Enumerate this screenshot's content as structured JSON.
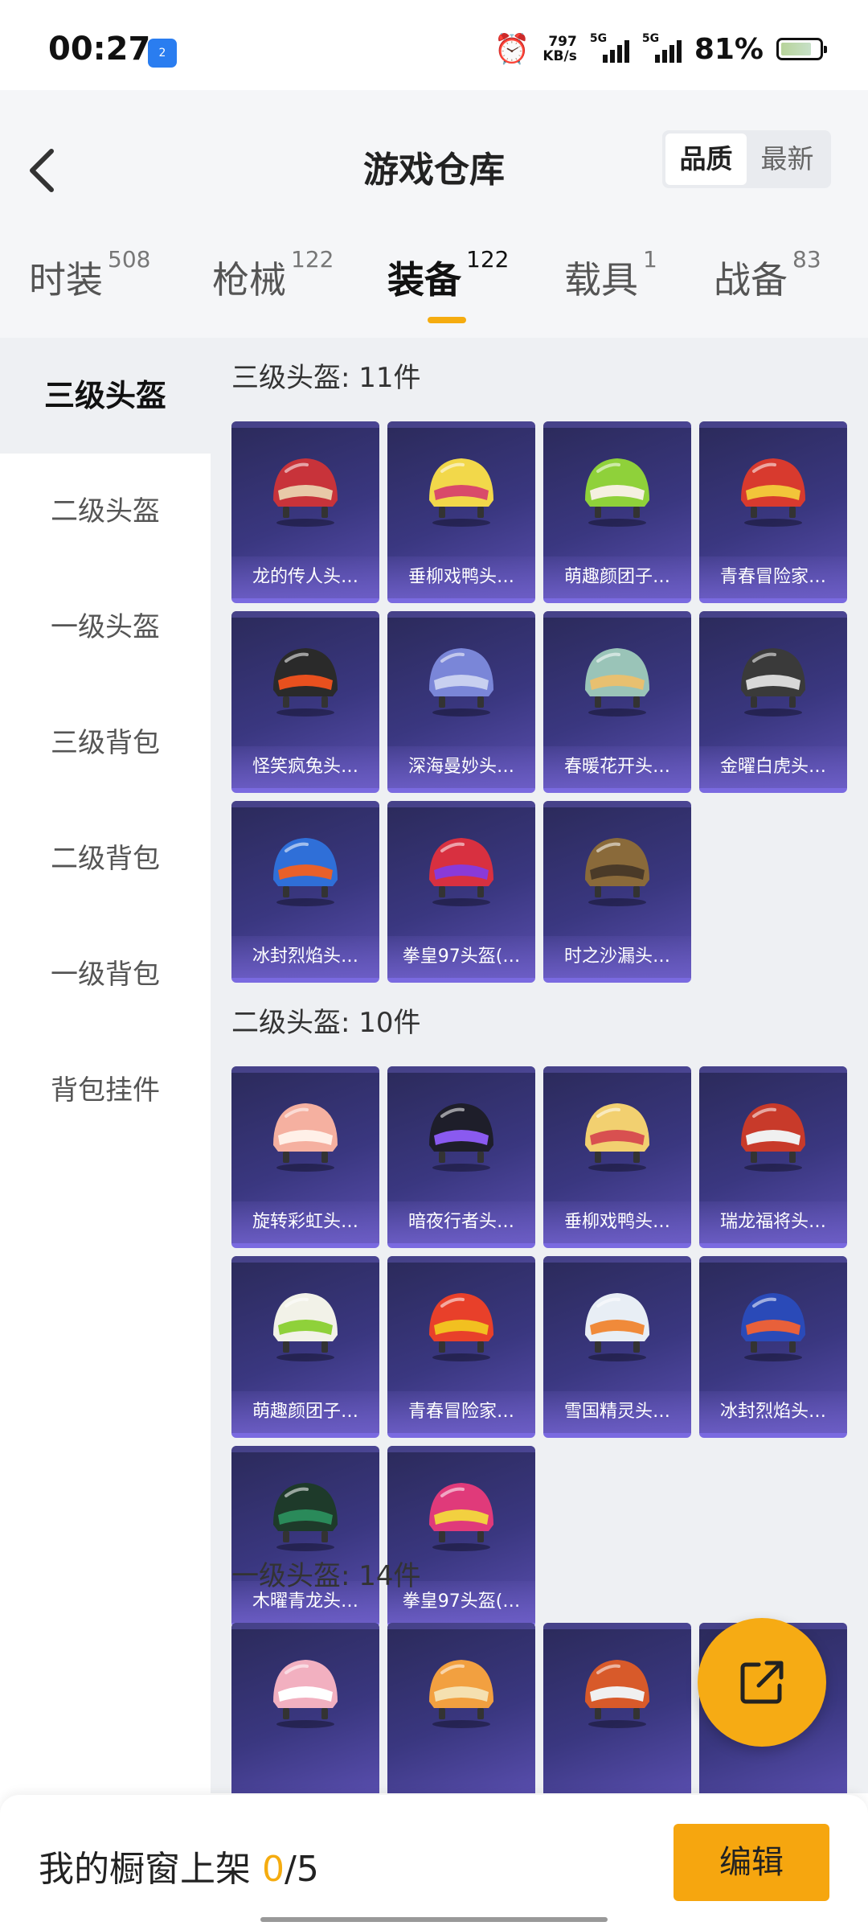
{
  "status_bar": {
    "time": "00:27",
    "badge": "2",
    "net_speed_top": "797",
    "net_speed_bottom": "KB/s",
    "signal1_label": "5G",
    "signal2_label": "5G",
    "battery": "81%",
    "battery_level": 0.81
  },
  "header": {
    "title": "游戏仓库",
    "sort_options": [
      "品质",
      "最新"
    ],
    "active_sort": "品质"
  },
  "tabs": [
    {
      "label": "时装",
      "count": "508"
    },
    {
      "label": "枪械",
      "count": "122"
    },
    {
      "label": "装备",
      "count": "122"
    },
    {
      "label": "载具",
      "count": "1"
    },
    {
      "label": "战备",
      "count": "83"
    }
  ],
  "active_tab": "装备",
  "sidebar": {
    "items": [
      "三级头盔",
      "二级头盔",
      "一级头盔",
      "三级背包",
      "二级背包",
      "一级背包",
      "背包挂件"
    ],
    "active": "三级头盔"
  },
  "sections": [
    {
      "title": "三级头盔: 11件",
      "items": [
        {
          "name": "龙的传人头…",
          "c1": "#c8333a",
          "c2": "#e8c9a8"
        },
        {
          "name": "垂柳戏鸭头…",
          "c1": "#f2d84a",
          "c2": "#d94a6a"
        },
        {
          "name": "萌趣颜团子…",
          "c1": "#8fd13a",
          "c2": "#f5f0e0"
        },
        {
          "name": "青春冒险家…",
          "c1": "#d83a2e",
          "c2": "#f2c53a"
        },
        {
          "name": "怪笑疯兔头…",
          "c1": "#2a2a2a",
          "c2": "#e8501e"
        },
        {
          "name": "深海曼妙头…",
          "c1": "#7a86d8",
          "c2": "#c8d0f0"
        },
        {
          "name": "春暖花开头…",
          "c1": "#9ac4b8",
          "c2": "#e8c070"
        },
        {
          "name": "金曜白虎头…",
          "c1": "#3a3a3a",
          "c2": "#d8d8d8"
        },
        {
          "name": "冰封烈焰头…",
          "c1": "#2f6fd8",
          "c2": "#e8602a"
        },
        {
          "name": "拳皇97头盔(…",
          "c1": "#d83040",
          "c2": "#8a3ad8"
        },
        {
          "name": "时之沙漏头…",
          "c1": "#8a6a3a",
          "c2": "#4a3a28"
        }
      ]
    },
    {
      "title": "二级头盔: 10件",
      "items": [
        {
          "name": "旋转彩虹头…",
          "c1": "#f5b0a0",
          "c2": "#fff0e8"
        },
        {
          "name": "暗夜行者头…",
          "c1": "#1e1e2a",
          "c2": "#8a5af0"
        },
        {
          "name": "垂柳戏鸭头…",
          "c1": "#f2d070",
          "c2": "#d85050"
        },
        {
          "name": "瑞龙福将头…",
          "c1": "#c83a2a",
          "c2": "#f0f0f0"
        },
        {
          "name": "萌趣颜团子…",
          "c1": "#f2f2e8",
          "c2": "#8fd13a"
        },
        {
          "name": "青春冒险家…",
          "c1": "#e8402a",
          "c2": "#f2c020"
        },
        {
          "name": "雪国精灵头…",
          "c1": "#e8eef5",
          "c2": "#f08a3a"
        },
        {
          "name": "冰封烈焰头…",
          "c1": "#2a4ab8",
          "c2": "#e8603a"
        },
        {
          "name": "木曜青龙头…",
          "c1": "#1e3a2a",
          "c2": "#2a8a5a"
        },
        {
          "name": "拳皇97头盔(…",
          "c1": "#e03a7a",
          "c2": "#f2d040"
        }
      ]
    },
    {
      "title": "一级头盔: 14件",
      "items": [
        {
          "name": "",
          "c1": "#f2b0c0",
          "c2": "#ffffff"
        },
        {
          "name": "",
          "c1": "#f2a040",
          "c2": "#f5e0b0"
        },
        {
          "name": "",
          "c1": "#d85a2a",
          "c2": "#f0f0f0"
        },
        {
          "name": "",
          "c1": "#f0f0e0",
          "c2": "#9ad13a"
        }
      ]
    }
  ],
  "bottom_bar": {
    "shelf_label": "我的橱窗上架",
    "shelf_current": "0",
    "shelf_total": "/5",
    "edit_label": "编辑"
  },
  "colors": {
    "accent": "#f5ac10",
    "card_bg": "#3a3780",
    "content_bg": "#eef0f3"
  },
  "icons": {
    "back": "chevron-left-icon",
    "fab": "share-external-icon",
    "alarm": "alarm-icon"
  }
}
